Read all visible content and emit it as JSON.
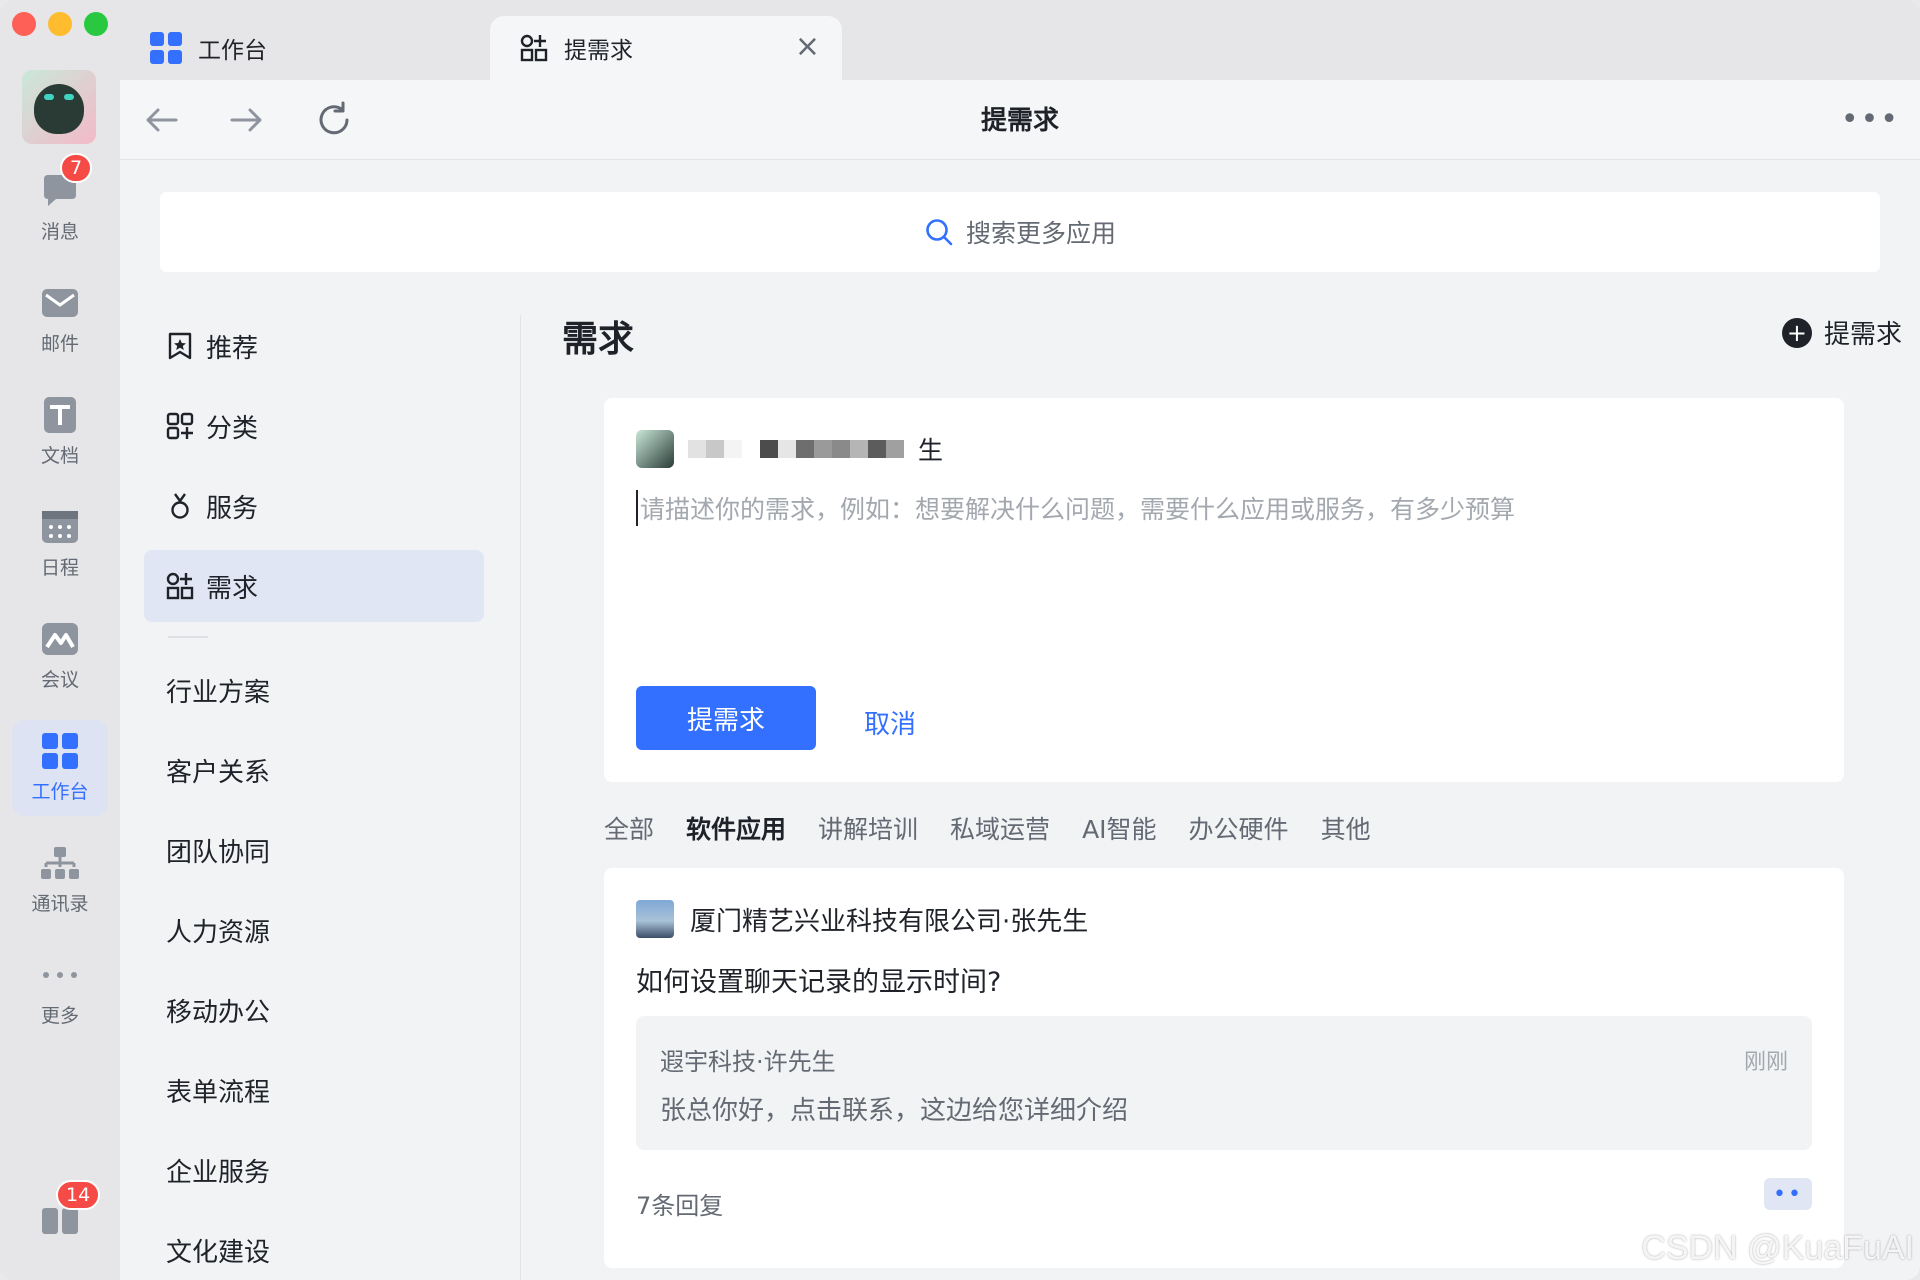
{
  "rail": {
    "items": [
      {
        "label": "消息",
        "icon": "chat-bubble-icon",
        "badge": "7"
      },
      {
        "label": "邮件",
        "icon": "mail-icon"
      },
      {
        "label": "文档",
        "icon": "document-icon"
      },
      {
        "label": "日程",
        "icon": "calendar-icon"
      },
      {
        "label": "会议",
        "icon": "meeting-icon"
      },
      {
        "label": "工作台",
        "icon": "workplace-icon",
        "active": true
      },
      {
        "label": "通讯录",
        "icon": "contacts-icon"
      },
      {
        "label": "更多",
        "icon": "more-icon"
      }
    ],
    "bottom_badge": "14"
  },
  "tabs": [
    {
      "label": "工作台"
    },
    {
      "label": "提需求"
    }
  ],
  "navbar": {
    "title": "提需求"
  },
  "search": {
    "placeholder": "搜索更多应用"
  },
  "sidebar": {
    "items": [
      {
        "label": "推荐"
      },
      {
        "label": "分类"
      },
      {
        "label": "服务"
      },
      {
        "label": "需求"
      }
    ],
    "categories": [
      "行业方案",
      "客户关系",
      "团队协同",
      "人力资源",
      "移动办公",
      "表单流程",
      "企业服务",
      "文化建设"
    ]
  },
  "main": {
    "title": "需求",
    "add_label": "提需求",
    "compose": {
      "user_suffix": "生",
      "placeholder": "请描述你的需求，例如：想要解决什么问题，需要什么应用或服务，有多少预算",
      "submit": "提需求",
      "cancel": "取消"
    },
    "filters": [
      "全部",
      "软件应用",
      "讲解培训",
      "私域运营",
      "AI智能",
      "办公硬件",
      "其他"
    ],
    "post": {
      "author": "厦门精艺兴业科技有限公司·张先生",
      "question": "如何设置聊天记录的显示时间?",
      "reply": {
        "name": "遐宇科技·许先生",
        "time": "刚刚",
        "text": "张总你好，点击联系，这边给您详细介绍"
      },
      "reply_count": "7条回复"
    }
  },
  "watermark": "CSDN @KuaFuAI",
  "colors": {
    "accent": "#3370ff",
    "badge": "#f54a45"
  }
}
